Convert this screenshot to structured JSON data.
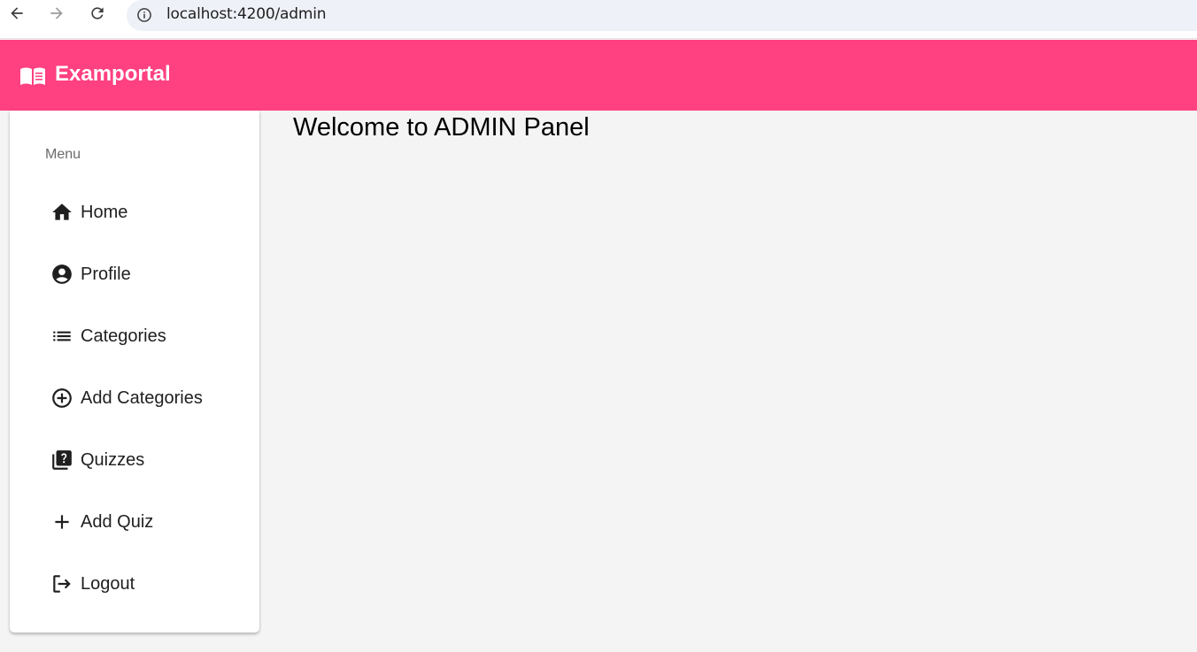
{
  "browser": {
    "url": "localhost:4200/admin"
  },
  "header": {
    "title": "Examportal",
    "color": "#ff4081",
    "icon": "menu-book-icon"
  },
  "sidebar": {
    "heading": "Menu",
    "items": [
      {
        "label": "Home",
        "icon": "home-icon"
      },
      {
        "label": "Profile",
        "icon": "account-circle-icon"
      },
      {
        "label": "Categories",
        "icon": "list-icon"
      },
      {
        "label": "Add Categories",
        "icon": "add-circle-outline-icon"
      },
      {
        "label": "Quizzes",
        "icon": "quiz-icon"
      },
      {
        "label": "Add Quiz",
        "icon": "add-icon"
      },
      {
        "label": "Logout",
        "icon": "logout-icon"
      }
    ]
  },
  "main": {
    "title": "Welcome to ADMIN Panel"
  }
}
